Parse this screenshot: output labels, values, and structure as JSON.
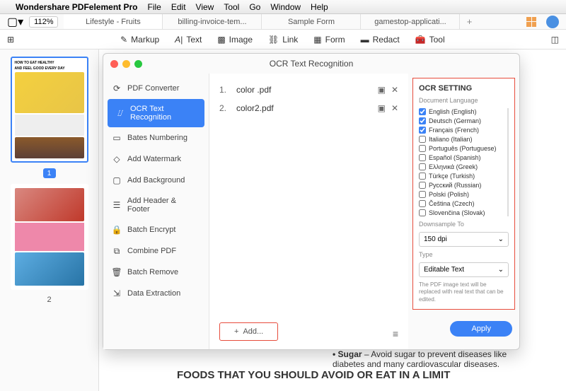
{
  "menubar": {
    "app": "Wondershare PDFelement Pro",
    "items": [
      "File",
      "Edit",
      "View",
      "Tool",
      "Go",
      "Window",
      "Help"
    ]
  },
  "topbar": {
    "zoom": "112%",
    "tabs": [
      "Lifestyle - Fruits",
      "billing-invoice-tem...",
      "Sample Form",
      "gamestop-applicati..."
    ]
  },
  "toolbar": {
    "markup": "Markup",
    "text": "Text",
    "image": "Image",
    "link": "Link",
    "form": "Form",
    "redact": "Redact",
    "tool": "Tool"
  },
  "thumbs": {
    "page1": "1",
    "page2": "2",
    "title1": "HOW TO EAT HEALTHY",
    "title2": "AND FEEL GOOD EVERY DAY"
  },
  "modal": {
    "title": "OCR Text Recognition",
    "tools": [
      "PDF Converter",
      "OCR Text Recognition",
      "Bates Numbering",
      "Add Watermark",
      "Add Background",
      "Add Header & Footer",
      "Batch Encrypt",
      "Combine PDF",
      "Batch Remove",
      "Data Extraction"
    ],
    "files": [
      {
        "n": "1.",
        "name": "color .pdf"
      },
      {
        "n": "2.",
        "name": "color2.pdf"
      }
    ],
    "add": "Add...",
    "settings": {
      "heading": "OCR SETTING",
      "lang_label": "Document Language",
      "langs": [
        {
          "label": "English (English)",
          "checked": true
        },
        {
          "label": "Deutsch (German)",
          "checked": true
        },
        {
          "label": "Français (French)",
          "checked": true
        },
        {
          "label": "Italiano (Italian)",
          "checked": false
        },
        {
          "label": "Português (Portuguese)",
          "checked": false
        },
        {
          "label": "Español (Spanish)",
          "checked": false
        },
        {
          "label": "Ελληνικά (Greek)",
          "checked": false
        },
        {
          "label": "Türkçe (Turkish)",
          "checked": false
        },
        {
          "label": "Русский (Russian)",
          "checked": false
        },
        {
          "label": "Polski (Polish)",
          "checked": false
        },
        {
          "label": "Čeština (Czech)",
          "checked": false
        },
        {
          "label": "Slovenčina (Slovak)",
          "checked": false
        }
      ],
      "downsample_label": "Downsample To",
      "downsample_value": "150 dpi",
      "type_label": "Type",
      "type_value": "Editable Text",
      "hint": "The PDF image text will be replaced with real text that can be edited.",
      "apply": "Apply"
    }
  },
  "doc": {
    "heading": "FOODS THAT YOU SHOULD AVOID OR EAT IN A LIMIT",
    "bullet_label": "• Sugar",
    "bullet_text": " – Avoid sugar to prevent diseases like diabetes and many cardiovascular diseases."
  }
}
